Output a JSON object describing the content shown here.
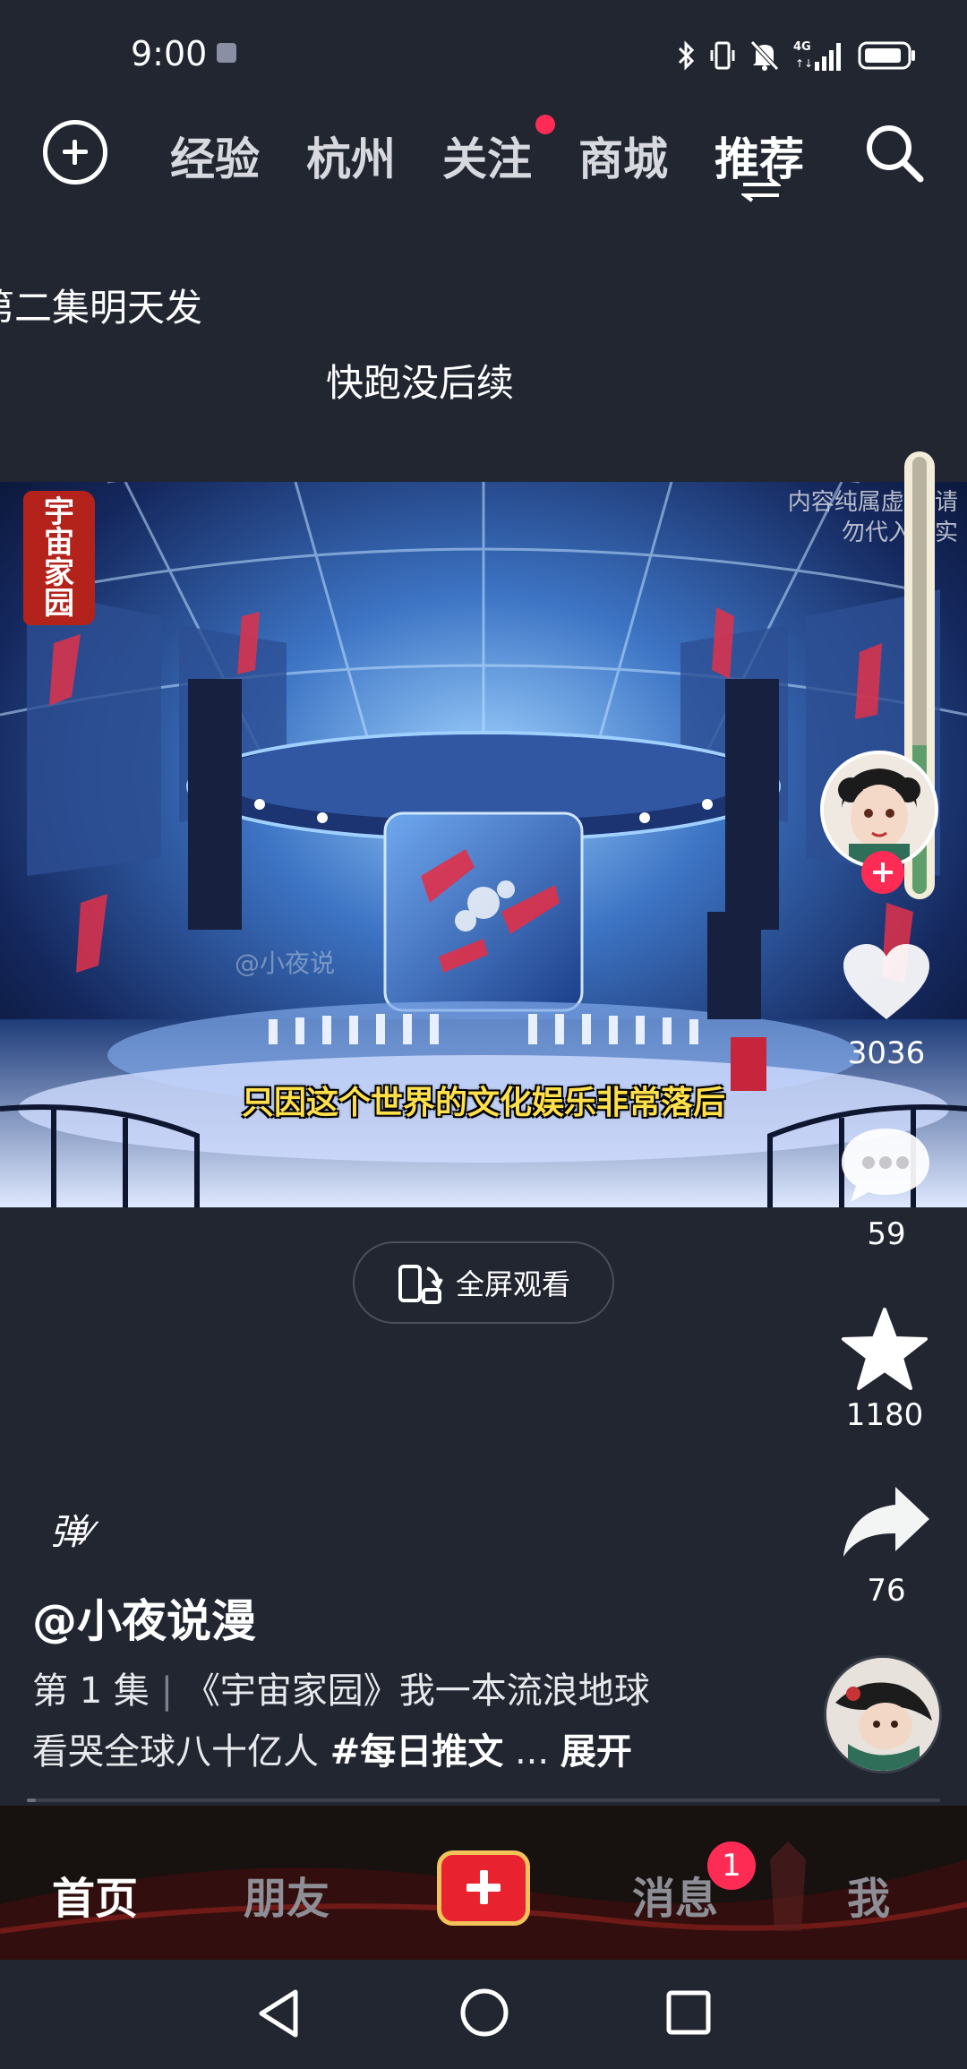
{
  "status_bar": {
    "time": "9:00",
    "icons": [
      "bluetooth-icon",
      "vibrate-icon",
      "mute-icon",
      "signal-4g-icon",
      "battery-icon"
    ]
  },
  "top_nav": {
    "tabs": [
      "经验",
      "杭州",
      "关注",
      "商城",
      "推荐"
    ],
    "active_tab": "推荐",
    "follow_has_dot": true
  },
  "danmaku": [
    "第二集明天发",
    "快跑没后续"
  ],
  "video": {
    "seal_text": "宇宙家园",
    "disclaimer": "内容纯属虚构 请勿代入现实",
    "watermark": "@小夜说",
    "subtitle": "只因这个世界的文化娱乐非常落后",
    "fullscreen_label": "全屏观看"
  },
  "actions": {
    "progress_fraction": 0.34,
    "likes": "3036",
    "comments": "59",
    "favorites": "1180",
    "shares": "76"
  },
  "info": {
    "danmaku_toggle": "弹",
    "author": "@小夜说漫",
    "episode": "第 1 集",
    "separator": "|",
    "title_line1": "《宇宙家园》我一本流浪地球",
    "title_line2": "看哭全球八十亿人",
    "hashtag": "#每日推文",
    "ellipsis": "...",
    "expand": "展开"
  },
  "tabbar": {
    "home": "首页",
    "friends": "朋友",
    "messages": "消息",
    "messages_badge": "1",
    "me": "我"
  },
  "colors": {
    "background": "#212630",
    "accent": "#fe2c55",
    "subtitle": "#ffe04a"
  }
}
